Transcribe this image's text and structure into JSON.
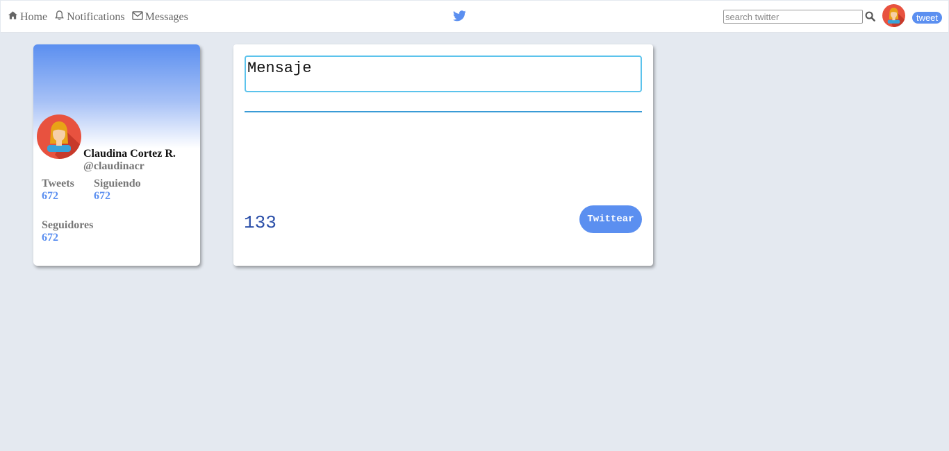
{
  "navbar": {
    "items": [
      {
        "label": "Home",
        "icon": "home-icon"
      },
      {
        "label": "Notifications",
        "icon": "bell-icon"
      },
      {
        "label": "Messages",
        "icon": "envelope-icon"
      }
    ],
    "logo_icon": "twitter-bird-icon",
    "search_placeholder": "search twitter",
    "tweet_label": "tweet"
  },
  "profile": {
    "name": "Claudina Cortez R.",
    "handle": "@claudinacr",
    "stats": {
      "tweets": {
        "label": "Tweets",
        "value": "672"
      },
      "following": {
        "label": "Siguiendo",
        "value": "672"
      },
      "followers": {
        "label": "Seguidores",
        "value": "672"
      }
    }
  },
  "compose": {
    "placeholder": "Mensaje",
    "counter": "133",
    "submit_label": "Twittear"
  },
  "colors": {
    "accent": "#5b8ff0",
    "background": "#e4e9f0",
    "input_border": "#5cc3ec",
    "counter": "#2a4ea8"
  }
}
